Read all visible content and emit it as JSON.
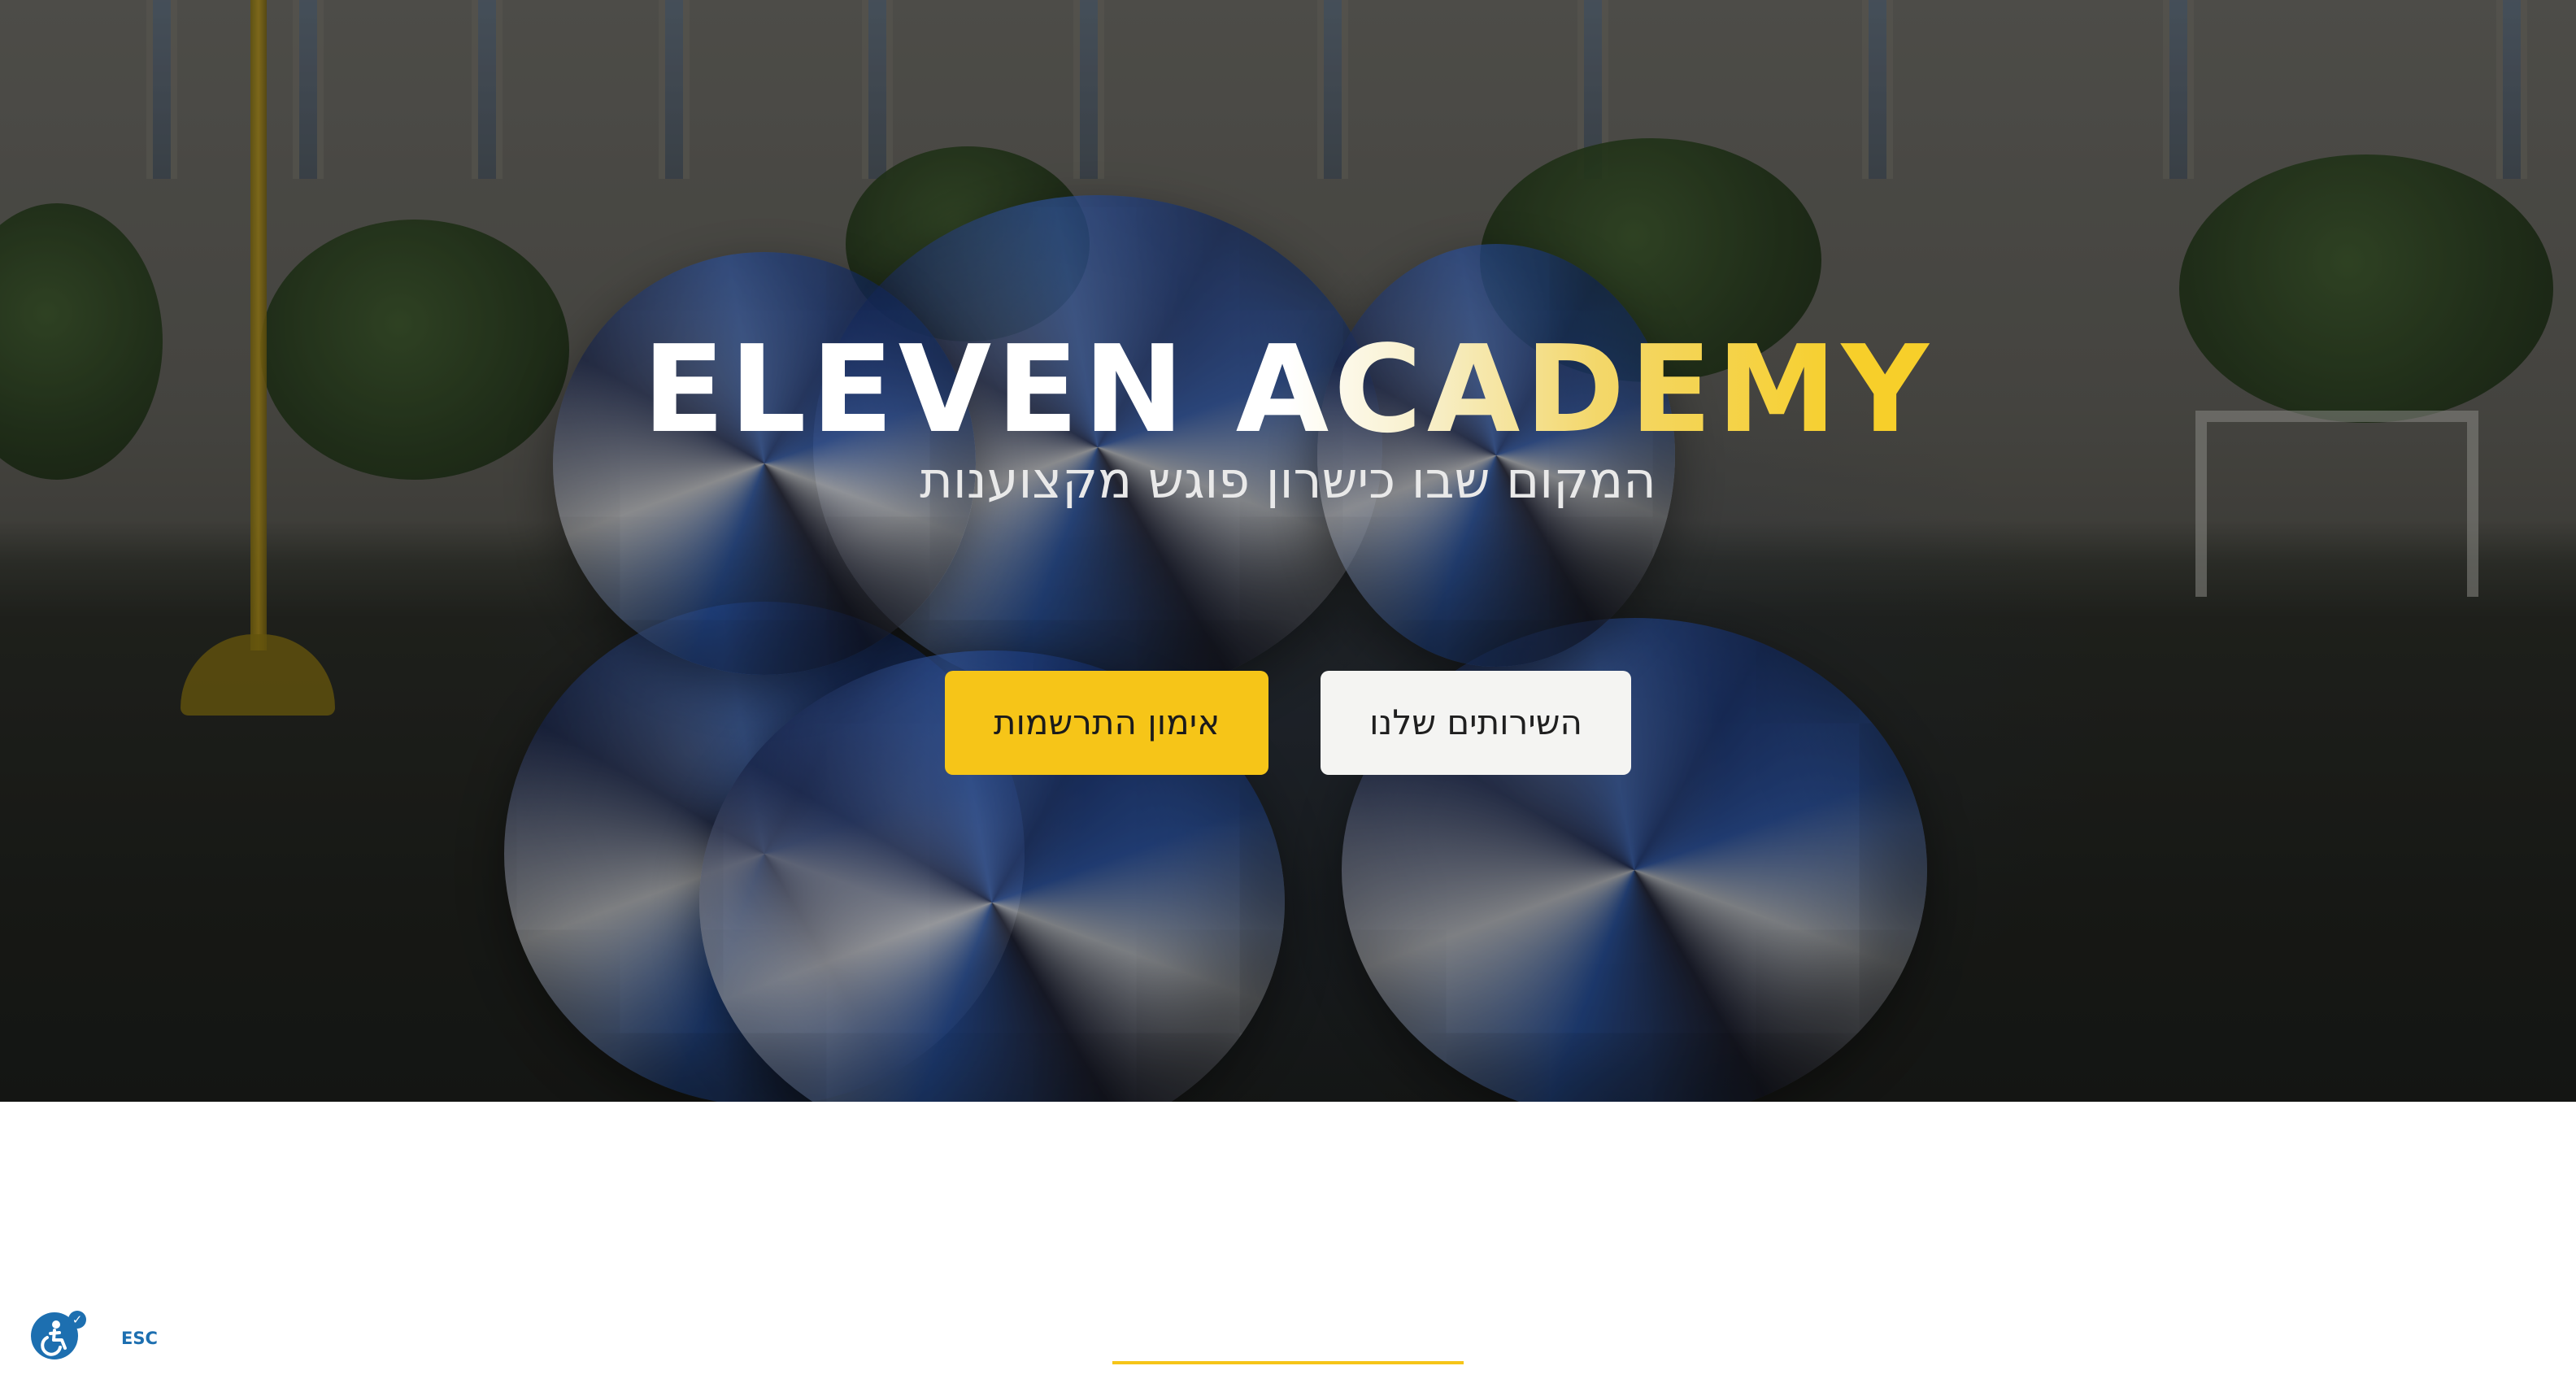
{
  "hero": {
    "title": "ELEVEN ACADEMY",
    "subtitle": "המקום שבו כישרון פוגש מקצוענות",
    "primary_button_label": "אימון התרשמות",
    "secondary_button_label": "השירותים שלנו"
  },
  "accessibility": {
    "esc_label": "ESC",
    "icon": "accessibility-icon",
    "check_icon": "check-icon"
  },
  "colors": {
    "accent": "#f6c518",
    "accessibility_blue": "#1d6fb0"
  }
}
